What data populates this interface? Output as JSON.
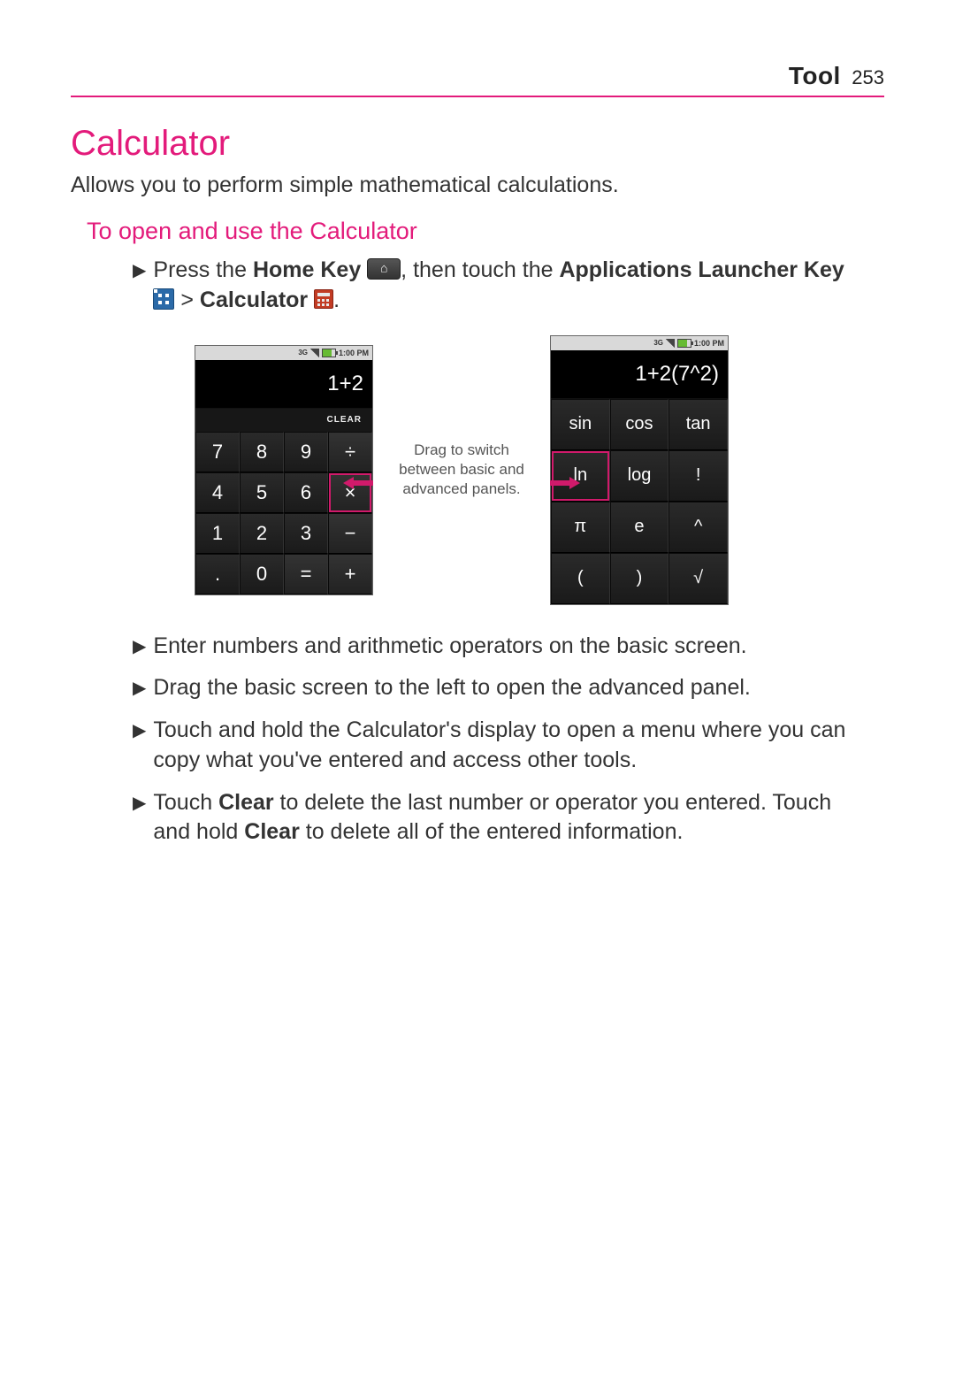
{
  "header": {
    "section": "Tool",
    "page": "253"
  },
  "title": "Calculator",
  "lead": "Allows you to perform simple mathematical calculations.",
  "subhead": "To open and use the Calculator",
  "first_bullet": {
    "p1": "Press the ",
    "home_key": "Home Key",
    "p2": ", then touch the ",
    "apps": "Applications Launcher Key",
    "gt": " > ",
    "calc": "Calculator",
    "dot": "."
  },
  "status": {
    "time": "1:00 PM"
  },
  "basic": {
    "display": "1+2",
    "clear": "CLEAR",
    "keys": [
      "7",
      "8",
      "9",
      "÷",
      "4",
      "5",
      "6",
      "×",
      "1",
      "2",
      "3",
      "−",
      ".",
      "0",
      "=",
      "+"
    ]
  },
  "advanced": {
    "display": "1+2(7^2)",
    "keys": [
      "sin",
      "cos",
      "tan",
      "ln",
      "log",
      "!",
      "π",
      "e",
      "^",
      "(",
      ")",
      "√"
    ]
  },
  "drag_note": {
    "l1": "Drag to switch",
    "l2": "between basic and",
    "l3": "advanced panels."
  },
  "bullets2": [
    "Enter numbers and arithmetic operators on the basic screen.",
    "Drag the basic screen to the left to open the advanced panel.",
    "Touch and hold the Calculator's display to open a menu where you can copy what you've entered and access other tools."
  ],
  "bullet_clear": {
    "p1": "Touch ",
    "b1": "Clear",
    "p2": " to delete the last number or operator you entered. Touch and hold ",
    "b2": "Clear",
    "p3": " to delete all of the entered information."
  }
}
